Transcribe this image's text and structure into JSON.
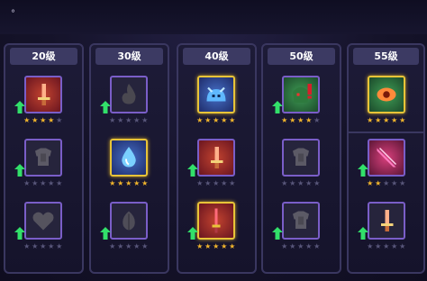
{
  "top_mark": "°",
  "columns": [
    {
      "label": "20级",
      "slots": [
        {
          "icon": "sword-icon",
          "frame": "purple",
          "bg": "red",
          "stars": 4,
          "upgrade": true
        },
        {
          "icon": "armor-icon",
          "frame": "purple",
          "bg": "dark",
          "stars": 0,
          "upgrade": true
        },
        {
          "icon": "heart-icon",
          "frame": "purple",
          "bg": "dark",
          "stars": 0,
          "upgrade": true
        }
      ]
    },
    {
      "label": "30级",
      "slots": [
        {
          "icon": "fire-icon",
          "frame": "purple",
          "bg": "dark",
          "stars": 0,
          "upgrade": true
        },
        {
          "icon": "water-drop-icon",
          "frame": "gold",
          "bg": "blue",
          "stars": 5,
          "upgrade": false
        },
        {
          "icon": "leaf-icon",
          "frame": "purple",
          "bg": "dark",
          "stars": 0,
          "upgrade": true
        }
      ]
    },
    {
      "label": "40级",
      "slots": [
        {
          "icon": "slime-icon",
          "frame": "gold",
          "bg": "blue",
          "stars": 5,
          "upgrade": false
        },
        {
          "icon": "sword-icon",
          "frame": "purple",
          "bg": "red",
          "stars": 0,
          "upgrade": true
        },
        {
          "icon": "dagger-icon",
          "frame": "gold",
          "bg": "red",
          "stars": 5,
          "upgrade": true
        }
      ]
    },
    {
      "label": "50级",
      "slots": [
        {
          "icon": "goblin-icon",
          "frame": "purple",
          "bg": "green",
          "stars": 4,
          "upgrade": true
        },
        {
          "icon": "armor-icon",
          "frame": "purple",
          "bg": "dark",
          "stars": 0,
          "upgrade": false
        },
        {
          "icon": "armor-icon",
          "frame": "purple",
          "bg": "dark",
          "stars": 0,
          "upgrade": true
        }
      ]
    },
    {
      "label": "55级",
      "slots": [
        {
          "icon": "eye-icon",
          "frame": "gold",
          "bg": "green",
          "stars": 5,
          "upgrade": false
        },
        {
          "icon": "slash-icon",
          "frame": "purple",
          "bg": "pink",
          "stars": 2,
          "upgrade": true
        },
        {
          "icon": "sword-icon",
          "frame": "purple",
          "bg": "dark",
          "stars": 0,
          "upgrade": true
        }
      ]
    }
  ],
  "colors": {
    "star_on": "#f0b42c",
    "star_off": "#58567a",
    "frame_gold": "#e8c438",
    "frame_purple": "#7a5ec8",
    "upgrade_arrow": "#32e06a"
  }
}
